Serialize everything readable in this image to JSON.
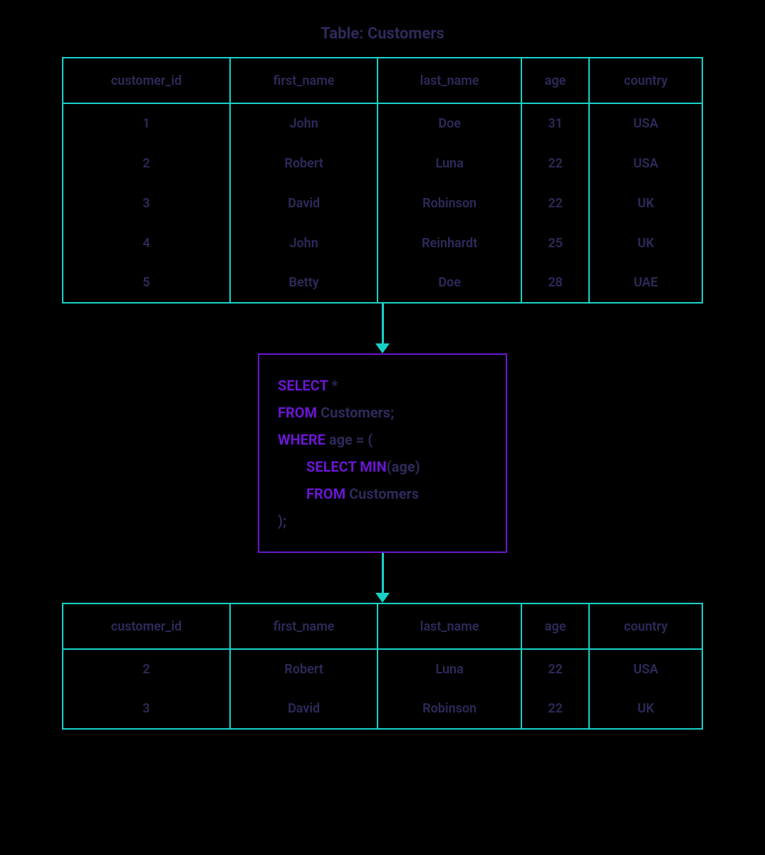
{
  "title": "Table: Customers",
  "columns": [
    "customer_id",
    "first_name",
    "last_name",
    "age",
    "country"
  ],
  "source_rows": [
    {
      "customer_id": "1",
      "first_name": "John",
      "last_name": "Doe",
      "age": "31",
      "country": "USA"
    },
    {
      "customer_id": "2",
      "first_name": "Robert",
      "last_name": "Luna",
      "age": "22",
      "country": "USA"
    },
    {
      "customer_id": "3",
      "first_name": "David",
      "last_name": "Robinson",
      "age": "22",
      "country": "UK"
    },
    {
      "customer_id": "4",
      "first_name": "John",
      "last_name": "Reinhardt",
      "age": "25",
      "country": "UK"
    },
    {
      "customer_id": "5",
      "first_name": "Betty",
      "last_name": "Doe",
      "age": "28",
      "country": "UAE"
    }
  ],
  "result_rows": [
    {
      "customer_id": "2",
      "first_name": "Robert",
      "last_name": "Luna",
      "age": "22",
      "country": "USA"
    },
    {
      "customer_id": "3",
      "first_name": "David",
      "last_name": "Robinson",
      "age": "22",
      "country": "UK"
    }
  ],
  "sql": {
    "select_kw": "SELECT",
    "select_rest": " *",
    "from_kw": "FROM",
    "from_rest": " Customers;",
    "where_kw": "WHERE",
    "where_rest": " age = (",
    "sub_select_kw": "SELECT MIN",
    "sub_select_rest": "(age)",
    "sub_from_kw": "FROM",
    "sub_from_rest": " Customers",
    "close": ");"
  }
}
